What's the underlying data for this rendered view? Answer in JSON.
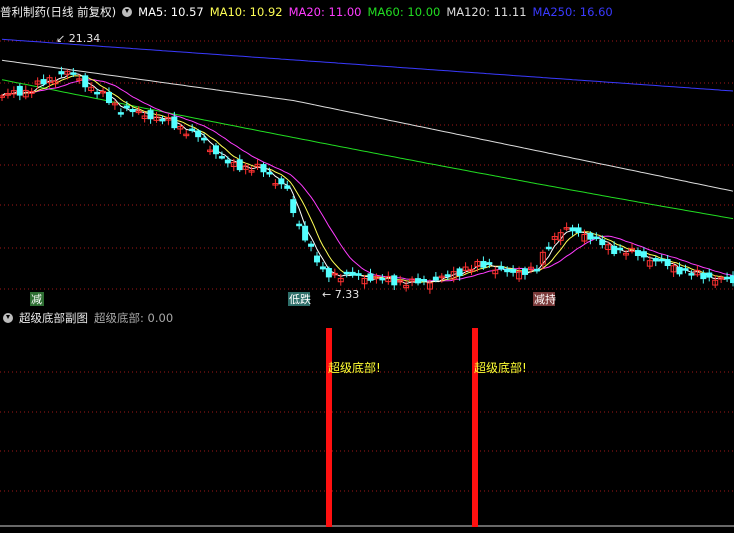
{
  "header": {
    "title": "普利制药(日线 前复权)",
    "ma": [
      {
        "label": "MA5: 10.57",
        "color": "#ffffff"
      },
      {
        "label": "MA10: 10.92",
        "color": "#ffff55"
      },
      {
        "label": "MA20: 11.00",
        "color": "#ff3cff"
      },
      {
        "label": "MA60: 10.00",
        "color": "#22dd22"
      },
      {
        "label": "MA120: 11.11",
        "color": "#dcdcdc"
      },
      {
        "label": "MA250: 16.60",
        "color": "#3a3aff"
      }
    ]
  },
  "subheader": {
    "title": "超级底部副图",
    "indicator": "超级底部: 0.00"
  },
  "colors": {
    "up": "#ff3232",
    "down": "#54ffff",
    "grid": "#a01818",
    "ma5": "#ffffff",
    "ma10": "#ffff55",
    "ma20": "#ff3cff",
    "ma60": "#22dd22",
    "ma120": "#dcdcdc",
    "ma250": "#3a3aff",
    "signal": "#ff1010",
    "signal_text": "#ffff33"
  },
  "annotations": {
    "high_label": "21.34",
    "low_label": "7.33",
    "tags": [
      {
        "text": "减",
        "bg": "#2e6f33"
      },
      {
        "text": "低跌",
        "bg": "#2e6f6a"
      },
      {
        "text": "减持",
        "bg": "#7a3a3a"
      }
    ]
  },
  "chart_data": {
    "type": "candlestick",
    "high": 21.34,
    "low": 7.33,
    "ma_last": {
      "MA5": 10.57,
      "MA10": 10.92,
      "MA20": 11.0,
      "MA60": 10.0,
      "MA120": 11.11,
      "MA250": 16.6
    },
    "indicator": {
      "name": "超级底部",
      "value": 0.0,
      "signals": [
        {
          "label": "超级底部!"
        },
        {
          "label": "超级底部!"
        }
      ]
    }
  }
}
